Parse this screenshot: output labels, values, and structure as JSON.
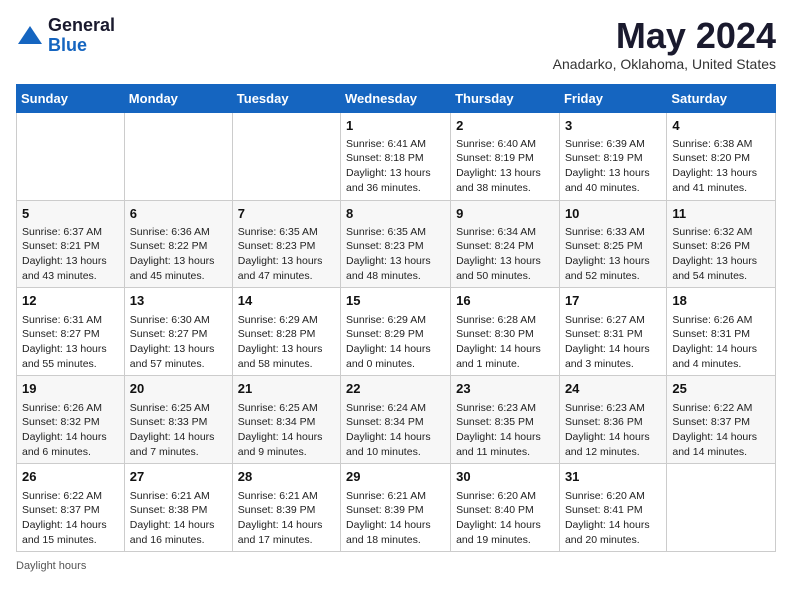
{
  "header": {
    "logo_general": "General",
    "logo_blue": "Blue",
    "month_title": "May 2024",
    "location": "Anadarko, Oklahoma, United States"
  },
  "days_of_week": [
    "Sunday",
    "Monday",
    "Tuesday",
    "Wednesday",
    "Thursday",
    "Friday",
    "Saturday"
  ],
  "weeks": [
    [
      {
        "day": "",
        "detail": ""
      },
      {
        "day": "",
        "detail": ""
      },
      {
        "day": "",
        "detail": ""
      },
      {
        "day": "1",
        "detail": "Sunrise: 6:41 AM\nSunset: 8:18 PM\nDaylight: 13 hours and 36 minutes."
      },
      {
        "day": "2",
        "detail": "Sunrise: 6:40 AM\nSunset: 8:19 PM\nDaylight: 13 hours and 38 minutes."
      },
      {
        "day": "3",
        "detail": "Sunrise: 6:39 AM\nSunset: 8:19 PM\nDaylight: 13 hours and 40 minutes."
      },
      {
        "day": "4",
        "detail": "Sunrise: 6:38 AM\nSunset: 8:20 PM\nDaylight: 13 hours and 41 minutes."
      }
    ],
    [
      {
        "day": "5",
        "detail": "Sunrise: 6:37 AM\nSunset: 8:21 PM\nDaylight: 13 hours and 43 minutes."
      },
      {
        "day": "6",
        "detail": "Sunrise: 6:36 AM\nSunset: 8:22 PM\nDaylight: 13 hours and 45 minutes."
      },
      {
        "day": "7",
        "detail": "Sunrise: 6:35 AM\nSunset: 8:23 PM\nDaylight: 13 hours and 47 minutes."
      },
      {
        "day": "8",
        "detail": "Sunrise: 6:35 AM\nSunset: 8:23 PM\nDaylight: 13 hours and 48 minutes."
      },
      {
        "day": "9",
        "detail": "Sunrise: 6:34 AM\nSunset: 8:24 PM\nDaylight: 13 hours and 50 minutes."
      },
      {
        "day": "10",
        "detail": "Sunrise: 6:33 AM\nSunset: 8:25 PM\nDaylight: 13 hours and 52 minutes."
      },
      {
        "day": "11",
        "detail": "Sunrise: 6:32 AM\nSunset: 8:26 PM\nDaylight: 13 hours and 54 minutes."
      }
    ],
    [
      {
        "day": "12",
        "detail": "Sunrise: 6:31 AM\nSunset: 8:27 PM\nDaylight: 13 hours and 55 minutes."
      },
      {
        "day": "13",
        "detail": "Sunrise: 6:30 AM\nSunset: 8:27 PM\nDaylight: 13 hours and 57 minutes."
      },
      {
        "day": "14",
        "detail": "Sunrise: 6:29 AM\nSunset: 8:28 PM\nDaylight: 13 hours and 58 minutes."
      },
      {
        "day": "15",
        "detail": "Sunrise: 6:29 AM\nSunset: 8:29 PM\nDaylight: 14 hours and 0 minutes."
      },
      {
        "day": "16",
        "detail": "Sunrise: 6:28 AM\nSunset: 8:30 PM\nDaylight: 14 hours and 1 minute."
      },
      {
        "day": "17",
        "detail": "Sunrise: 6:27 AM\nSunset: 8:31 PM\nDaylight: 14 hours and 3 minutes."
      },
      {
        "day": "18",
        "detail": "Sunrise: 6:26 AM\nSunset: 8:31 PM\nDaylight: 14 hours and 4 minutes."
      }
    ],
    [
      {
        "day": "19",
        "detail": "Sunrise: 6:26 AM\nSunset: 8:32 PM\nDaylight: 14 hours and 6 minutes."
      },
      {
        "day": "20",
        "detail": "Sunrise: 6:25 AM\nSunset: 8:33 PM\nDaylight: 14 hours and 7 minutes."
      },
      {
        "day": "21",
        "detail": "Sunrise: 6:25 AM\nSunset: 8:34 PM\nDaylight: 14 hours and 9 minutes."
      },
      {
        "day": "22",
        "detail": "Sunrise: 6:24 AM\nSunset: 8:34 PM\nDaylight: 14 hours and 10 minutes."
      },
      {
        "day": "23",
        "detail": "Sunrise: 6:23 AM\nSunset: 8:35 PM\nDaylight: 14 hours and 11 minutes."
      },
      {
        "day": "24",
        "detail": "Sunrise: 6:23 AM\nSunset: 8:36 PM\nDaylight: 14 hours and 12 minutes."
      },
      {
        "day": "25",
        "detail": "Sunrise: 6:22 AM\nSunset: 8:37 PM\nDaylight: 14 hours and 14 minutes."
      }
    ],
    [
      {
        "day": "26",
        "detail": "Sunrise: 6:22 AM\nSunset: 8:37 PM\nDaylight: 14 hours and 15 minutes."
      },
      {
        "day": "27",
        "detail": "Sunrise: 6:21 AM\nSunset: 8:38 PM\nDaylight: 14 hours and 16 minutes."
      },
      {
        "day": "28",
        "detail": "Sunrise: 6:21 AM\nSunset: 8:39 PM\nDaylight: 14 hours and 17 minutes."
      },
      {
        "day": "29",
        "detail": "Sunrise: 6:21 AM\nSunset: 8:39 PM\nDaylight: 14 hours and 18 minutes."
      },
      {
        "day": "30",
        "detail": "Sunrise: 6:20 AM\nSunset: 8:40 PM\nDaylight: 14 hours and 19 minutes."
      },
      {
        "day": "31",
        "detail": "Sunrise: 6:20 AM\nSunset: 8:41 PM\nDaylight: 14 hours and 20 minutes."
      },
      {
        "day": "",
        "detail": ""
      }
    ]
  ],
  "footer": {
    "daylight_label": "Daylight hours"
  }
}
